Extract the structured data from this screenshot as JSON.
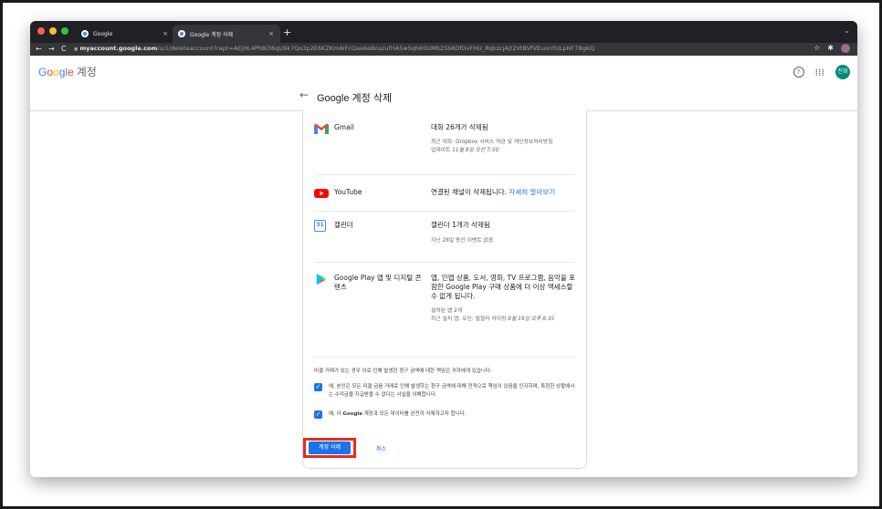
{
  "browser": {
    "tabs": [
      {
        "title": "Google",
        "close": "×"
      },
      {
        "title": "Google 계정 삭제",
        "close": "×"
      }
    ],
    "new_tab": "+",
    "tab_menu": "⌄",
    "back": "←",
    "forward": "→",
    "reload": "C",
    "url_host": "myaccount.google.com",
    "url_path": "/u/1/deleteaccount?rapt=AEjHL4PhBi36qU9k7Qo3p2E6KZKmAiFcQaa6eBnszufHA5w5qhK0UMb25bKOfOvFHU_RqkzcjAjt2VtBVfVEuonYULpNF7BgKQ",
    "lock": "●",
    "star": "☆",
    "ext": "✱"
  },
  "header": {
    "logo": [
      {
        "t": "G",
        "c": "#4285f4"
      },
      {
        "t": "o",
        "c": "#ea4335"
      },
      {
        "t": "o",
        "c": "#fbbc05"
      },
      {
        "t": "g",
        "c": "#4285f4"
      },
      {
        "t": "l",
        "c": "#34a853"
      },
      {
        "t": "e",
        "c": "#ea4335"
      }
    ],
    "account_label": "계정",
    "help": "?",
    "apps": "⋮⋮⋮",
    "avatar": "진희"
  },
  "page": {
    "back_arrow": "←",
    "title": "Google 계정 삭제"
  },
  "services": [
    {
      "name": "Gmail",
      "main": "대화 26개가 삭제됨",
      "sub1": "최근 대화: Dropbox 서비스 약관 및 개인정보처리방침",
      "sub2_pre": "업데이트 ",
      "sub2_it": "11월 8일 오전 7:50"
    },
    {
      "name": "YouTube",
      "main_pre": "연결된 채널이 삭제됩니다. ",
      "main_link": "자세히 알아보기"
    },
    {
      "name": "캘린더",
      "icon_text": "31",
      "main": "캘린더 1개가 삭제됨",
      "sub1": "지난 28일 동안 이벤트 없음"
    },
    {
      "name": "Google Play 앱 및 디지털 콘텐츠",
      "main": "앱, 인앱 상품, 도서, 영화, TV 프로그램, 음악을 포함한 Google Play 구매 상품에 더 이상 액세스할 수 없게 됩니다.",
      "sub1": "설치된 앱 2개",
      "sub2_pre": "최근 설치 앱: 오딘: 발할라 라이징 ",
      "sub2_it": "8월 19일 오후 8:35"
    }
  ],
  "notice": "미결 거래가 있는 경우 이로 인해 발생한 청구 금액에 대한 책임은 귀하에게 있습니다.",
  "checkboxes": [
    {
      "mark": "✓",
      "text": "예, 본인은 모든 미결 금융 거래로 인해 발생하는 청구 금액에 대해 전적으로 책임이 있음을 인지하며, 특정한 상황에서는 수익금을 지급받을 수 없다는 사실을 이해합니다."
    },
    {
      "mark": "✓",
      "text_pre": "예, 이 ",
      "text_bold": "Google",
      "text_post": " 계정과 모든 데이터를 완전히 삭제하고자 합니다."
    }
  ],
  "buttons": {
    "delete": "계정 삭제",
    "cancel": "취소"
  }
}
